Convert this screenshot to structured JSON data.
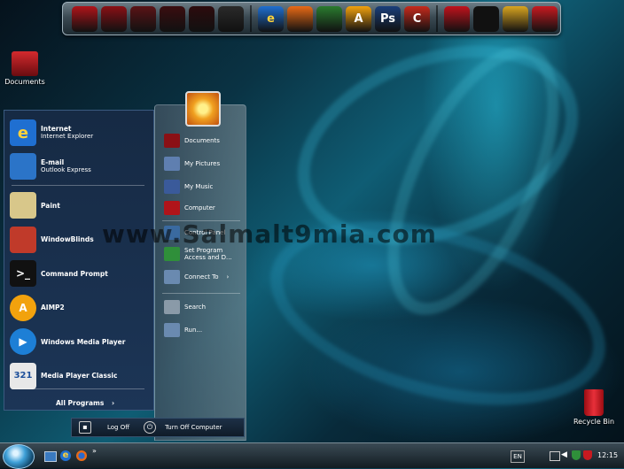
{
  "dock": {
    "icons": [
      {
        "name": "documents-folder-icon",
        "color": "#b0141a",
        "glyph": ""
      },
      {
        "name": "pictures-folder-icon",
        "color": "#8a1015",
        "glyph": ""
      },
      {
        "name": "music-folder-icon",
        "color": "#5a1316",
        "glyph": ""
      },
      {
        "name": "video-folder-icon",
        "color": "#3a0d10",
        "glyph": ""
      },
      {
        "name": "downloads-folder-icon",
        "color": "#2c0b0d",
        "glyph": ""
      },
      {
        "name": "folder-icon",
        "color": "#2a2a2a",
        "glyph": ""
      },
      {
        "name": "internet-explorer-icon",
        "color": "#1f6fd1",
        "glyph": "e"
      },
      {
        "name": "firefox-icon",
        "color": "#e86a16",
        "glyph": ""
      },
      {
        "name": "network-icon",
        "color": "#2a7b2f",
        "glyph": ""
      },
      {
        "name": "aimp-icon",
        "color": "#f2a20d",
        "glyph": "A"
      },
      {
        "name": "photoshop-icon",
        "color": "#1a3f7a",
        "glyph": "Ps"
      },
      {
        "name": "ccleaner-icon",
        "color": "#c62a1c",
        "glyph": "C"
      },
      {
        "name": "globe-icon",
        "color": "#c0121c",
        "glyph": ""
      },
      {
        "name": "tshirt-icon",
        "color": "#111111",
        "glyph": ""
      },
      {
        "name": "tools-icon",
        "color": "#d9a520",
        "glyph": ""
      },
      {
        "name": "recycle-bin-icon",
        "color": "#c81a20",
        "glyph": ""
      }
    ]
  },
  "desktop": {
    "documents_label": "Documents",
    "recycle_bin_label": "Recycle Bin"
  },
  "watermark": "www.Salmalt9mia.com",
  "start_menu": {
    "pinned": [
      {
        "title": "Internet",
        "subtitle": "Internet Explorer",
        "color": "#1f6fd1",
        "glyph": "e"
      },
      {
        "title": "E-mail",
        "subtitle": "Outlook Express",
        "color": "#2b74c8",
        "glyph": ""
      }
    ],
    "programs": [
      {
        "label": "Paint",
        "color": "#d8c78a",
        "glyph": ""
      },
      {
        "label": "WindowBlinds",
        "color": "#c03a2a",
        "glyph": ""
      },
      {
        "label": "Command Prompt",
        "color": "#111111",
        "glyph": ">_"
      },
      {
        "label": "AIMP2",
        "color": "#f2a20d",
        "glyph": "A"
      },
      {
        "label": "Windows Media Player",
        "color": "#1d7fd6",
        "glyph": "▶"
      },
      {
        "label": "Media Player Classic",
        "color": "#e8e8e8",
        "glyph": "321"
      }
    ],
    "all_programs_label": "All Programs",
    "places": [
      {
        "label": "Documents",
        "color": "#8a1015"
      },
      {
        "label": "My Pictures",
        "color": "#5f7fb0"
      },
      {
        "label": "My Music",
        "color": "#3a5a9a"
      },
      {
        "label": "Computer",
        "color": "#b0141a"
      },
      {
        "label": "Control Panel",
        "color": "#3a6aa0"
      },
      {
        "label": "Set Program Access and D...",
        "color": "#2f8f3a"
      },
      {
        "label": "Connect To",
        "color": "#6a8ab0"
      },
      {
        "label": "Search",
        "color": "#8a9aa8"
      },
      {
        "label": "Run...",
        "color": "#6a8ab0"
      }
    ],
    "log_off_label": "Log Off",
    "turn_off_label": "Turn Off Computer"
  },
  "taskbar": {
    "language": "EN",
    "clock": "12:15"
  }
}
